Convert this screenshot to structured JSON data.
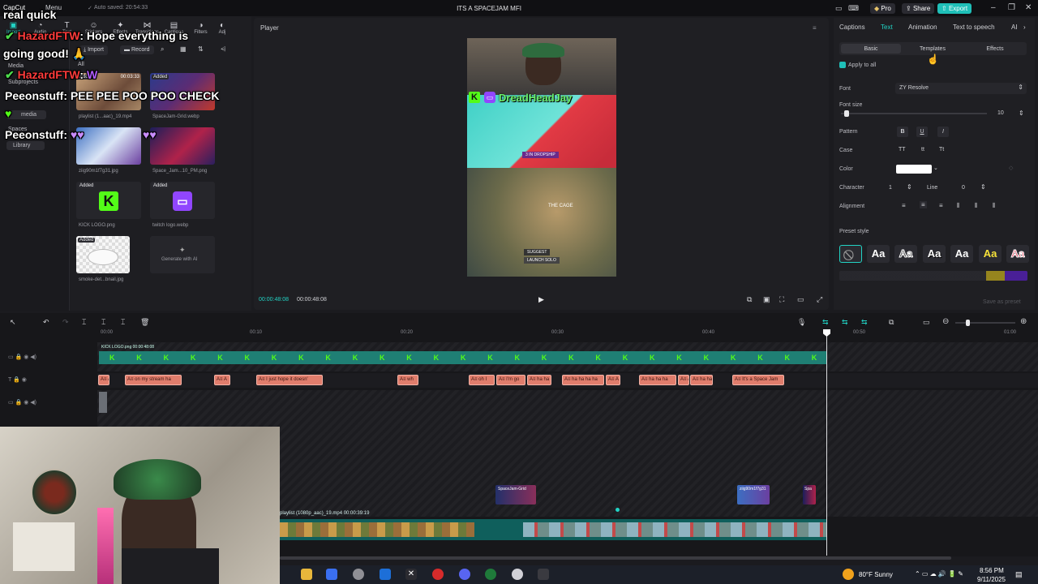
{
  "app": {
    "name": "CapCut",
    "menu_label": "Menu",
    "autosave": "Auto saved: 20:54:33",
    "project_title": "ITS A SPACEJAM MFI",
    "pro_label": "Pro",
    "share_label": "Share",
    "export_label": "Export"
  },
  "left_tools": [
    "Import",
    "Audio",
    "Text",
    "Stickers",
    "Effects",
    "Transitions",
    "Captions",
    "Filters",
    "Adj"
  ],
  "left_nav": {
    "all": "All",
    "media": "Media",
    "subprojects": "Subprojects",
    "media_item": "media",
    "spaces": "Spaces",
    "library": "Library"
  },
  "media_toolbar": {
    "import": "Import",
    "record": "Record"
  },
  "media_items": [
    {
      "name": "playlist (1...aac)_19.mp4",
      "duration": "00:03:33",
      "added": "Added"
    },
    {
      "name": "SpaceJam-Grid.webp",
      "added": "Added"
    },
    {
      "name": "ziig90m1f7g31.jpg",
      "added": ""
    },
    {
      "name": "Space_Jam...10_PM.png",
      "added": ""
    },
    {
      "name": "KICK LOGO.png",
      "added": "Added"
    },
    {
      "name": "twitch logo.webp",
      "added": "Added"
    },
    {
      "name": "smoke-det...bnail.jpg",
      "added": "Added"
    },
    {
      "name": "Generate with AI",
      "added": ""
    }
  ],
  "player": {
    "title": "Player",
    "current_time": "00:00:48:08",
    "total_time": "00:00:48:08",
    "overlay_name": "DreadHeadJay",
    "game_banner": "3 IN DROPSHIP",
    "game_location": "THE CAGE",
    "suggest_label": "SUGGEST",
    "launch_label": "LAUNCH SOLO"
  },
  "right_panel": {
    "tabs": [
      "Captions",
      "Text",
      "Animation",
      "Text to speech",
      "AI"
    ],
    "active_tab": "Text",
    "subtabs": [
      "Basic",
      "Templates",
      "Effects"
    ],
    "apply_to_all": "Apply to all",
    "font_label": "Font",
    "font_value": "ZY Resolve",
    "font_size_label": "Font size",
    "font_size_value": "10",
    "font_size_level": 0.02,
    "pattern_label": "Pattern",
    "pattern_buttons": [
      "B",
      "U",
      "I"
    ],
    "case_label": "Case",
    "case_buttons": [
      "TT",
      "tt",
      "Tt"
    ],
    "color_label": "Color",
    "color_value": "#ffffff",
    "character_label": "Character",
    "character_value": "1",
    "line_label": "Line",
    "line_value": "0",
    "alignment_label": "Alignment",
    "preset_label": "Preset style",
    "preset_sample": "Aa",
    "save_preset": "Save as preset"
  },
  "timeline": {
    "ruler": [
      "00:00",
      "00:10",
      "00:20",
      "00:30",
      "00:40",
      "00:50",
      "01:00"
    ],
    "kick_track_label": "KICK LOGO.png 00:00:48:08",
    "text_clips": [
      "A",
      "on my stream ha",
      "A",
      "I just hope it doesn'",
      "wh",
      "oh I",
      "I'm go",
      "ha ha",
      "ha ha ha ha",
      "A",
      "ha ha ha",
      "A",
      "ha ha",
      "It's a Space Jam"
    ],
    "overlay_clips": [
      "SpaceJam-Grid",
      "ziig90m1f7g31",
      "Spa"
    ],
    "main_clip_label": "playlist (1080p_aac)_19.mp4  00:00:39:19"
  },
  "chat": [
    {
      "user": "",
      "message": "real quick"
    },
    {
      "user": "HazardFTW",
      "message": ": Hope everything is"
    },
    {
      "user": "",
      "message": "going good! 🙏"
    },
    {
      "user": "HazardFTW",
      "message": ":"
    },
    {
      "user": "Peeonstuff",
      "message": ": PEE PEE POO POO CHECK"
    },
    {
      "user": "Peeonstuff",
      "message": ":"
    }
  ],
  "taskbar": {
    "weather": "80°F  Sunny",
    "time": "8:56 PM",
    "date": "9/11/2025"
  },
  "colors": {
    "accent": "#22d3c5",
    "export": "#1fbfb8",
    "kick_green": "#53fc18",
    "twitch_purple": "#9146ff",
    "text_clip": "#e07d6c",
    "chat_user": "#ff3b3b"
  }
}
